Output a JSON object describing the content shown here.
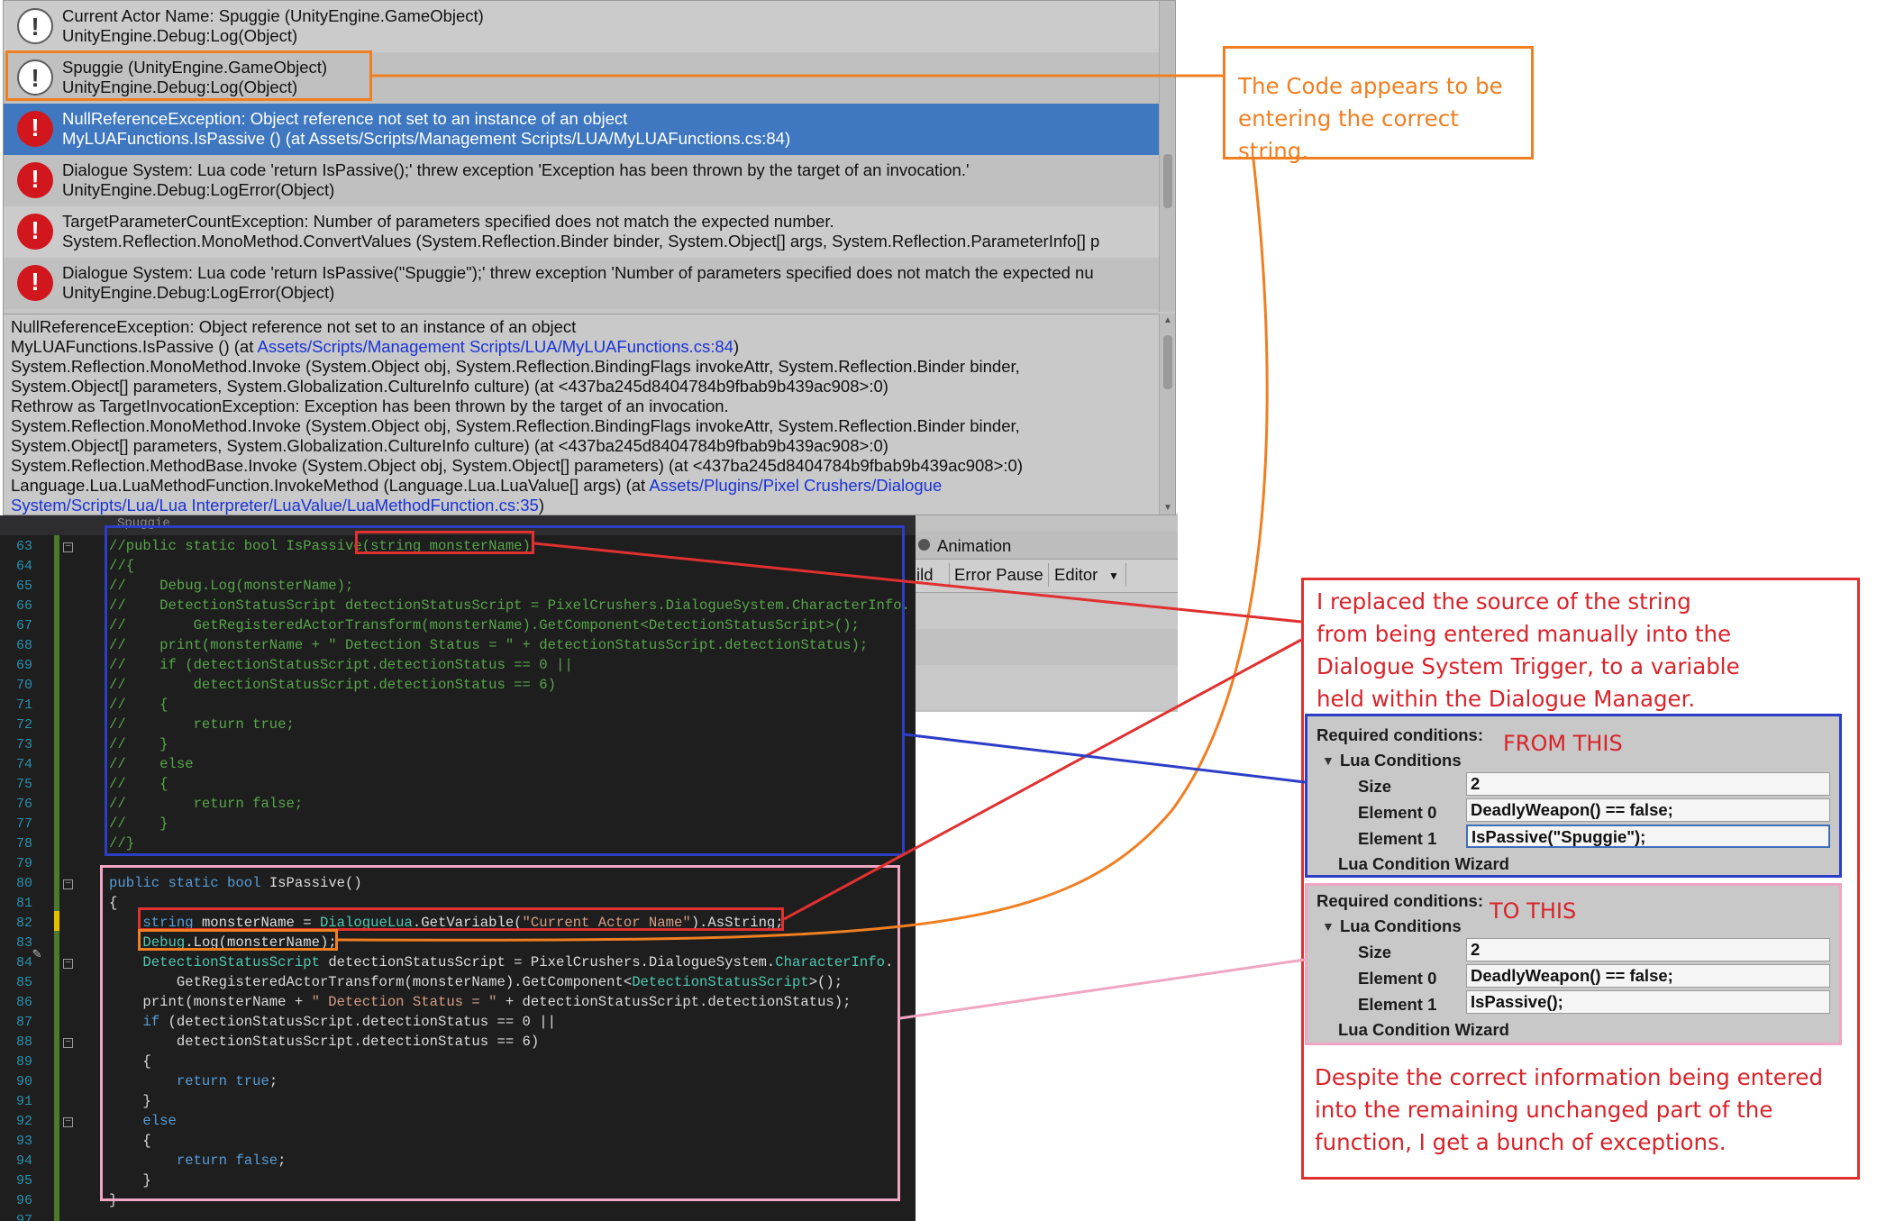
{
  "console": {
    "logs": [
      {
        "type": "info",
        "line1": "Current Actor Name: Spuggie (UnityEngine.GameObject)",
        "line2": "UnityEngine.Debug:Log(Object)"
      },
      {
        "type": "info",
        "line1": "Spuggie (UnityEngine.GameObject)",
        "line2": "UnityEngine.Debug:Log(Object)"
      },
      {
        "type": "error",
        "line1": "NullReferenceException: Object reference not set to an instance of an object",
        "line2": "MyLUAFunctions.IsPassive () (at Assets/Scripts/Management Scripts/LUA/MyLUAFunctions.cs:84)"
      },
      {
        "type": "error",
        "line1": "Dialogue System: Lua code 'return IsPassive();' threw exception 'Exception has been thrown by the target of an invocation.'",
        "line2": "UnityEngine.Debug:LogError(Object)"
      },
      {
        "type": "error",
        "line1": "TargetParameterCountException: Number of parameters specified does not match the expected number.",
        "line2": "System.Reflection.MonoMethod.ConvertValues (System.Reflection.Binder binder, System.Object[] args, System.Reflection.ParameterInfo[] p"
      },
      {
        "type": "error",
        "line1": "Dialogue System: Lua code 'return IsPassive(\"Spuggie\");' threw exception 'Number of parameters specified does not match the expected nu",
        "line2": "UnityEngine.Debug:LogError(Object)"
      }
    ],
    "selected_index": 2,
    "detail": {
      "l1": "NullReferenceException: Object reference not set to an instance of an object",
      "l2a": "MyLUAFunctions.IsPassive () (at ",
      "l2link": "Assets/Scripts/Management Scripts/LUA/MyLUAFunctions.cs:84",
      "l2b": ")",
      "l3": "System.Reflection.MonoMethod.Invoke (System.Object obj, System.Reflection.BindingFlags invokeAttr, System.Reflection.Binder binder,",
      "l4": "System.Object[] parameters, System.Globalization.CultureInfo culture) (at <437ba245d8404784b9fbab9b439ac908>:0)",
      "l5": "Rethrow as TargetInvocationException: Exception has been thrown by the target of an invocation.",
      "l6": "System.Reflection.MonoMethod.Invoke (System.Object obj, System.Reflection.BindingFlags invokeAttr, System.Reflection.Binder binder,",
      "l7": "System.Object[] parameters, System.Globalization.CultureInfo culture) (at <437ba245d8404784b9fbab9b439ac908>:0)",
      "l8": "System.Reflection.MethodBase.Invoke (System.Object obj, System.Object[] parameters) (at <437ba245d8404784b9fbab9b439ac908>:0)",
      "l9a": "Language.Lua.LuaMethodFunction.InvokeMethod (Language.Lua.LuaValue[] args) (at ",
      "l9link": "Assets/Plugins/Pixel Crushers/Dialogue",
      "l10link": "System/Scripts/Lua/Lua Interpreter/LuaValue/LuaMethodFunction.cs:35",
      "l10b": ")"
    }
  },
  "editor": {
    "tab_fragment": "Spuggie",
    "lines": [
      {
        "n": "63",
        "parts": [
          [
            "c-com",
            "//public static bool IsPassive(string monsterName)"
          ]
        ]
      },
      {
        "n": "64",
        "parts": [
          [
            "c-com",
            "//{"
          ]
        ]
      },
      {
        "n": "65",
        "parts": [
          [
            "c-com",
            "//    Debug.Log(monsterName);"
          ]
        ]
      },
      {
        "n": "66",
        "parts": [
          [
            "c-com",
            "//    DetectionStatusScript detectionStatusScript = PixelCrushers.DialogueSystem.CharacterInfo."
          ]
        ]
      },
      {
        "n": "67",
        "parts": [
          [
            "c-com",
            "//        GetRegisteredActorTransform(monsterName).GetComponent<DetectionStatusScript>();"
          ]
        ]
      },
      {
        "n": "68",
        "parts": [
          [
            "c-com",
            "//    print(monsterName + \" Detection Status = \" + detectionStatusScript.detectionStatus);"
          ]
        ]
      },
      {
        "n": "69",
        "parts": [
          [
            "c-com",
            "//    if (detectionStatusScript.detectionStatus == 0 ||"
          ]
        ]
      },
      {
        "n": "70",
        "parts": [
          [
            "c-com",
            "//        detectionStatusScript.detectionStatus == 6)"
          ]
        ]
      },
      {
        "n": "71",
        "parts": [
          [
            "c-com",
            "//    {"
          ]
        ]
      },
      {
        "n": "72",
        "parts": [
          [
            "c-com",
            "//        return true;"
          ]
        ]
      },
      {
        "n": "73",
        "parts": [
          [
            "c-com",
            "//    }"
          ]
        ]
      },
      {
        "n": "74",
        "parts": [
          [
            "c-com",
            "//    else"
          ]
        ]
      },
      {
        "n": "75",
        "parts": [
          [
            "c-com",
            "//    {"
          ]
        ]
      },
      {
        "n": "76",
        "parts": [
          [
            "c-com",
            "//        return false;"
          ]
        ]
      },
      {
        "n": "77",
        "parts": [
          [
            "c-com",
            "//    }"
          ]
        ]
      },
      {
        "n": "78",
        "parts": [
          [
            "c-com",
            "//}"
          ]
        ]
      },
      {
        "n": "79",
        "parts": []
      },
      {
        "n": "80",
        "parts": [
          [
            "c-kw",
            "public static bool "
          ],
          [
            "c-txt",
            "IsPassive()"
          ]
        ]
      },
      {
        "n": "81",
        "parts": [
          [
            "c-txt",
            "{"
          ]
        ]
      },
      {
        "n": "82",
        "parts": [
          [
            "c-kw",
            "    string "
          ],
          [
            "c-txt",
            "monsterName = "
          ],
          [
            "c-ty",
            "DialogueLua"
          ],
          [
            "c-txt",
            ".GetVariable("
          ],
          [
            "c-str",
            "\"Current Actor Name\""
          ],
          [
            "c-txt",
            ").AsString;"
          ]
        ]
      },
      {
        "n": "83",
        "parts": [
          [
            "c-ty",
            "    Debug"
          ],
          [
            "c-txt",
            ".Log(monsterName);"
          ]
        ]
      },
      {
        "n": "84",
        "parts": [
          [
            "c-ty",
            "    DetectionStatusScript "
          ],
          [
            "c-txt",
            "detectionStatusScript = PixelCrushers.DialogueSystem."
          ],
          [
            "c-ty",
            "CharacterInfo"
          ],
          [
            "c-txt",
            "."
          ]
        ]
      },
      {
        "n": "85",
        "parts": [
          [
            "c-txt",
            "        GetRegisteredActorTransform(monsterName).GetComponent<"
          ],
          [
            "c-ty",
            "DetectionStatusScript"
          ],
          [
            "c-txt",
            ">();"
          ]
        ]
      },
      {
        "n": "86",
        "parts": [
          [
            "c-txt",
            "    print(monsterName + "
          ],
          [
            "c-str",
            "\" Detection Status = \""
          ],
          [
            "c-txt",
            " + detectionStatusScript.detectionStatus);"
          ]
        ]
      },
      {
        "n": "87",
        "parts": [
          [
            "c-kw",
            "    if "
          ],
          [
            "c-txt",
            "(detectionStatusScript.detectionStatus == 0 ||"
          ]
        ]
      },
      {
        "n": "88",
        "parts": [
          [
            "c-txt",
            "        detectionStatusScript.detectionStatus == 6)"
          ]
        ]
      },
      {
        "n": "89",
        "parts": [
          [
            "c-txt",
            "    {"
          ]
        ]
      },
      {
        "n": "90",
        "parts": [
          [
            "c-kw",
            "        return true"
          ],
          [
            "c-txt",
            ";"
          ]
        ]
      },
      {
        "n": "91",
        "parts": [
          [
            "c-txt",
            "    }"
          ]
        ]
      },
      {
        "n": "92",
        "parts": [
          [
            "c-kw",
            "    else"
          ]
        ]
      },
      {
        "n": "93",
        "parts": [
          [
            "c-txt",
            "    {"
          ]
        ]
      },
      {
        "n": "94",
        "parts": [
          [
            "c-kw",
            "        return false"
          ],
          [
            "c-txt",
            ";"
          ]
        ]
      },
      {
        "n": "95",
        "parts": [
          [
            "c-txt",
            "    }"
          ]
        ]
      },
      {
        "n": "96",
        "parts": [
          [
            "c-txt",
            "}"
          ]
        ]
      },
      {
        "n": "97",
        "parts": []
      }
    ]
  },
  "unity_bg": {
    "animation_tab": "Animation",
    "toolbar": [
      "ild",
      "Error Pause",
      "Editor"
    ]
  },
  "annotations": {
    "orange_note": [
      "The Code appears to be",
      "entering the correct string."
    ],
    "red_note_top": [
      "I replaced the source of the string",
      "from being entered manually into the",
      "Dialogue System Trigger, to a variable",
      "held within the Dialogue Manager."
    ],
    "red_note_bottom": [
      "Despite the correct information being entered",
      "into the remaining unchanged part of the",
      "function, I get a bunch of exceptions."
    ],
    "from_label": "FROM THIS",
    "to_label": "TO THIS"
  },
  "inspector_from": {
    "required": "Required conditions:",
    "lua_conditions": "Lua Conditions",
    "size_label": "Size",
    "size": "2",
    "el0_label": "Element 0",
    "el0": "DeadlyWeapon() == false;",
    "el1_label": "Element 1",
    "el1": "IsPassive(\"Spuggie\");",
    "wizard": "Lua Condition Wizard"
  },
  "inspector_to": {
    "required": "Required conditions:",
    "lua_conditions": "Lua Conditions",
    "size_label": "Size",
    "size": "2",
    "el0_label": "Element 0",
    "el0": "DeadlyWeapon() == false;",
    "el1_label": "Element 1",
    "el1": "IsPassive();",
    "wizard": "Lua Condition Wizard"
  },
  "colors": {
    "orange": "#f07f22",
    "red": "#e03030",
    "blue": "#2d3ec6",
    "pink": "#f0a6c2",
    "selected": "#3f78c0"
  }
}
